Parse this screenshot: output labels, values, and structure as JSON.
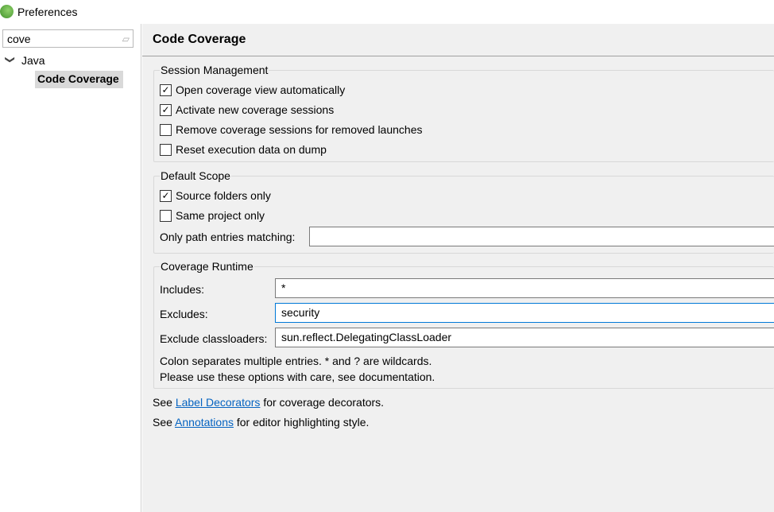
{
  "window": {
    "title": "Preferences"
  },
  "sidebar": {
    "filter_value": "cove",
    "tree": [
      {
        "label": "Java",
        "expanded": true,
        "children": [
          {
            "label": "Code Coverage",
            "selected": true
          }
        ]
      }
    ]
  },
  "page": {
    "title": "Code Coverage",
    "session": {
      "label": "Session Management",
      "options": [
        {
          "label": "Open coverage view automatically",
          "checked": true
        },
        {
          "label": "Activate new coverage sessions",
          "checked": true
        },
        {
          "label": "Remove coverage sessions for removed launches",
          "checked": false
        },
        {
          "label": "Reset execution data on dump",
          "checked": false
        }
      ]
    },
    "scope": {
      "label": "Default Scope",
      "options": [
        {
          "label": "Source folders only",
          "checked": true
        },
        {
          "label": "Same project only",
          "checked": false
        }
      ],
      "path_label": "Only path entries matching:",
      "path_value": ""
    },
    "runtime": {
      "label": "Coverage Runtime",
      "includes_label": "Includes:",
      "includes_value": "*",
      "excludes_label": "Excludes:",
      "excludes_value": "security",
      "classloaders_label": "Exclude classloaders:",
      "classloaders_value": "sun.reflect.DelegatingClassLoader",
      "note1": "Colon separates multiple entries. * and ? are wildcards.",
      "note2": "Please use these options with care, see documentation."
    },
    "link1": {
      "prefix": "See ",
      "link": "Label Decorators",
      "suffix": " for coverage decorators."
    },
    "link2": {
      "prefix": "See ",
      "link": "Annotations",
      "suffix": " for editor highlighting style."
    }
  }
}
